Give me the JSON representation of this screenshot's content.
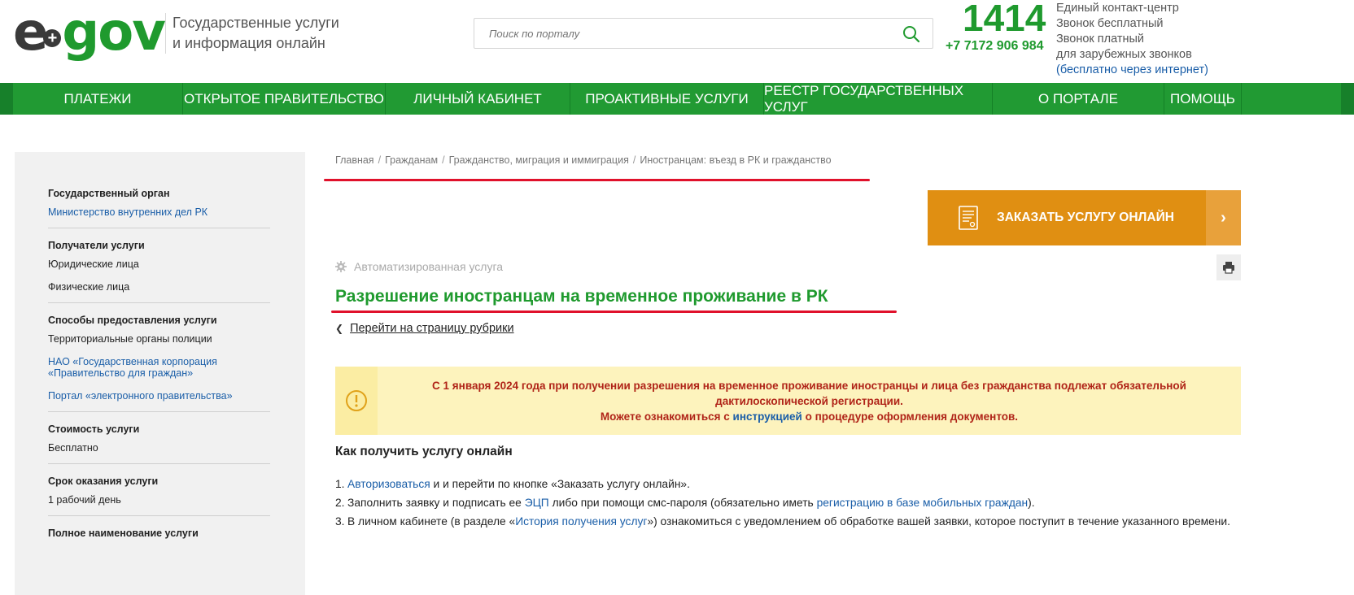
{
  "header": {
    "logo_e": "e",
    "logo_gov": "gov",
    "tagline_line1": "Государственные услуги",
    "tagline_line2": "и информация онлайн",
    "search_placeholder": "Поиск по порталу",
    "hotline": "1414",
    "phone": "+7 7172 906 984",
    "contact_line1": "Единый контакт-центр",
    "contact_line2": "Звонок бесплатный",
    "contact_line3": "Звонок платный",
    "contact_line4": "для зарубежных звонков",
    "contact_line5": "(бесплатно через интернет)"
  },
  "nav": {
    "items": [
      {
        "label": "Платежи"
      },
      {
        "label": "Открытое правительство"
      },
      {
        "label": "Личный кабинет"
      },
      {
        "label": "Проактивные услуги"
      },
      {
        "label": "Реестр государственных услуг"
      },
      {
        "label": "О портале"
      },
      {
        "label": "Помощь"
      }
    ]
  },
  "sidebar": {
    "sections": [
      {
        "title": "Государственный орган",
        "values": [
          {
            "text": "Министерство внутренних дел РК",
            "link": true
          }
        ]
      },
      {
        "title": "Получатели услуги",
        "values": [
          {
            "text": "Юридические лица"
          },
          {
            "text": "Физические лица"
          }
        ]
      },
      {
        "title": "Способы предоставления услуги",
        "values": [
          {
            "text": "Территориальные органы полиции"
          },
          {
            "text": "НАО «Государственная корпорация «Правительство для граждан»",
            "link": true
          },
          {
            "text": "Портал «электронного правительства»",
            "link": true
          }
        ]
      },
      {
        "title": "Стоимость услуги",
        "values": [
          {
            "text": "Бесплатно"
          }
        ]
      },
      {
        "title": "Срок оказания услуги",
        "values": [
          {
            "text": "1 рабочий день"
          }
        ]
      },
      {
        "title": "Полное наименование услуги",
        "values": []
      }
    ]
  },
  "breadcrumb": [
    "Главная",
    "Гражданам",
    "Гражданство, миграция и иммиграция",
    "Иностранцам: въезд в РК и гражданство"
  ],
  "order_button": {
    "label": "Заказать услугу онлайн",
    "arrow": "›"
  },
  "service": {
    "type_label": "Автоматизированная услуга",
    "title": "Разрешение иностранцам на временное проживание в РК",
    "back_link": "Перейти на страницу рубрики"
  },
  "notice": {
    "line1": "С 1 января 2024 года при получении разрешения на временное проживание иностранцы и лица без гражданства подлежат обязательной",
    "line2": "дактилоскопической регистрации.",
    "line3_before": "Можете ознакомиться с ",
    "line3_link": "инструкцией",
    "line3_after": " о процедуре оформления документов."
  },
  "howto": {
    "title": "Как получить услугу онлайн",
    "steps": [
      {
        "num": "1.",
        "parts": [
          {
            "t": "Авторизоваться",
            "link": true
          },
          {
            "t": " и и перейти по кнопке «Заказать услугу онлайн»."
          }
        ]
      },
      {
        "num": "2.",
        "parts": [
          {
            "t": "Заполнить заявку и подписать ее "
          },
          {
            "t": "ЭЦП",
            "link": true
          },
          {
            "t": " либо при помощи смс-пароля (обязательно иметь "
          },
          {
            "t": "регистрацию в базе мобильных граждан",
            "link": true
          },
          {
            "t": ")."
          }
        ]
      },
      {
        "num": "3.",
        "parts": [
          {
            "t": "В личном кабинете (в разделе «"
          },
          {
            "t": "История получения услуг",
            "link": true
          },
          {
            "t": "») ознакомиться с уведомлением об обработке вашей заявки, которое поступит в течение указанного времени."
          }
        ]
      }
    ]
  },
  "colors": {
    "brand_green": "#219a33",
    "accent_orange": "#e08f12",
    "annotation_red": "#e0112b",
    "link_blue": "#1a5ea8",
    "notice_bg": "#fdf3bd"
  }
}
